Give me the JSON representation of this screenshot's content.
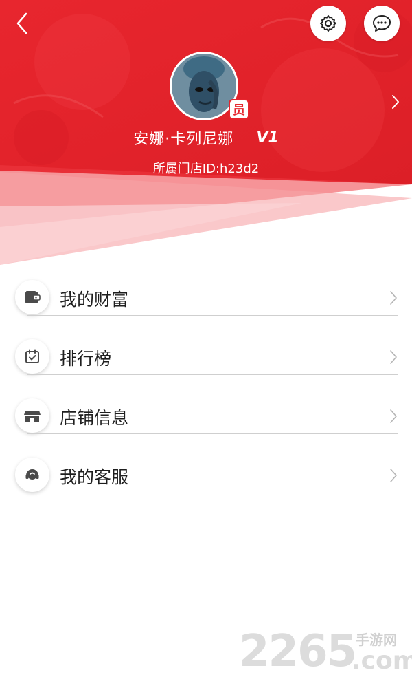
{
  "header": {
    "user_name": "安娜·卡列尼娜",
    "vip_level": "V1",
    "member_badge": "员",
    "store_id": "所属门店ID:h23d2",
    "accent_color": "#e6252d",
    "icons": {
      "back": "back-arrow-icon",
      "settings": "gear-icon",
      "messages": "chat-bubble-icon",
      "profile_arrow": "chevron-right-icon"
    }
  },
  "menu": {
    "items": [
      {
        "label": "我的财富",
        "icon": "wallet-icon"
      },
      {
        "label": "排行榜",
        "icon": "calendar-check-icon"
      },
      {
        "label": "店铺信息",
        "icon": "store-icon"
      },
      {
        "label": "我的客服",
        "icon": "headset-icon"
      }
    ]
  },
  "watermark": {
    "number": "2265",
    "site": "手游网",
    "tld": ".com"
  }
}
